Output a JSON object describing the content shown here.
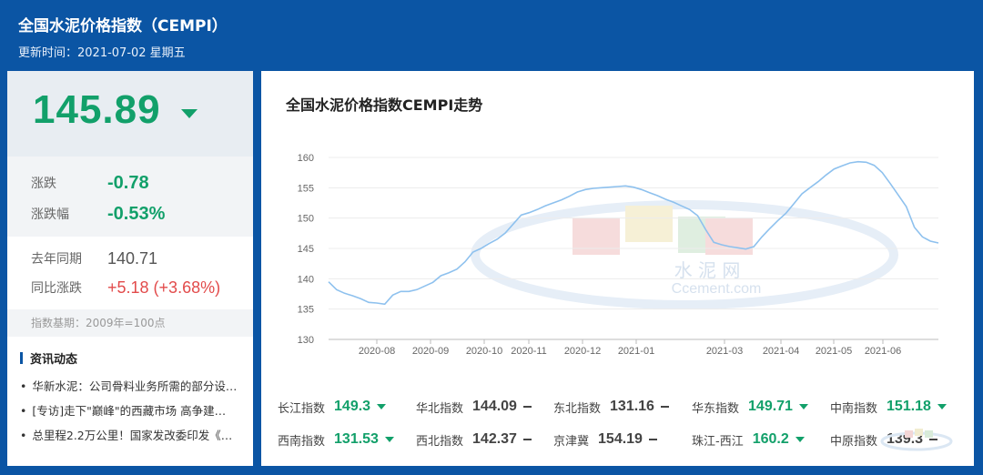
{
  "header": {
    "title": "全国水泥价格指数（CEMPI）",
    "updated": "更新时间：2021-07-02 星期五"
  },
  "summary": {
    "value": "145.89",
    "change_label": "涨跌",
    "change_value": "-0.78",
    "change_pct_label": "涨跌幅",
    "change_pct_value": "-0.53%",
    "last_year_label": "去年同期",
    "last_year_value": "140.71",
    "yoy_label": "同比涨跌",
    "yoy_value": "+5.18 (+3.68%)",
    "base_note": "指数基期：2009年=100点"
  },
  "news": {
    "title": "资讯动态",
    "items": [
      "华新水泥：公司骨料业务所需的部分设…",
      "[专访]走下\"巅峰\"的西藏市场 高争建…",
      "总里程2.2万公里！国家发改委印发《…"
    ]
  },
  "chart": {
    "title": "全国水泥价格指数CEMPI走势",
    "watermark_cn": "水 泥 网",
    "watermark_en": "Ccement.com",
    "line_color": "#8ec1ee"
  },
  "chart_data": {
    "type": "line",
    "ylim": [
      130,
      160
    ],
    "yticks": [
      "160",
      "155",
      "150",
      "145",
      "140",
      "135",
      "130"
    ],
    "xticks": [
      "2020-08",
      "2020-09",
      "2020-10",
      "2020-11",
      "2020-12",
      "2021-01",
      "2021-03",
      "2021-04",
      "2021-05",
      "2021-06"
    ],
    "values": [
      139.5,
      138.2,
      137.6,
      137.2,
      136.7,
      136.1,
      136.0,
      135.8,
      137.3,
      137.9,
      137.9,
      138.2,
      138.8,
      139.4,
      140.5,
      141.0,
      141.6,
      142.8,
      144.4,
      145.0,
      145.8,
      146.5,
      147.5,
      149.0,
      150.5,
      150.9,
      151.4,
      152.0,
      152.5,
      153.0,
      153.6,
      154.3,
      154.7,
      154.9,
      155.0,
      155.1,
      155.2,
      155.3,
      155.1,
      154.7,
      154.2,
      153.7,
      153.1,
      152.6,
      152.0,
      151.4,
      150.4,
      148.1,
      146.0,
      145.6,
      145.3,
      145.1,
      144.9,
      145.3,
      146.9,
      148.3,
      149.6,
      150.8,
      152.4,
      154.0,
      155.0,
      156.0,
      157.1,
      158.1,
      158.6,
      159.1,
      159.3,
      159.2,
      158.7,
      157.5,
      155.7,
      153.8,
      151.9,
      148.5,
      146.9,
      146.2,
      145.9
    ]
  },
  "indices": [
    {
      "name": "长江指数",
      "value": "149.3",
      "dir": "down"
    },
    {
      "name": "华北指数",
      "value": "144.09",
      "dir": "flat"
    },
    {
      "name": "东北指数",
      "value": "131.16",
      "dir": "flat"
    },
    {
      "name": "华东指数",
      "value": "149.71",
      "dir": "down"
    },
    {
      "name": "中南指数",
      "value": "151.18",
      "dir": "down"
    },
    {
      "name": "西南指数",
      "value": "131.53",
      "dir": "down"
    },
    {
      "name": "西北指数",
      "value": "142.37",
      "dir": "flat"
    },
    {
      "name": "京津冀",
      "value": "154.19",
      "dir": "flat"
    },
    {
      "name": "珠江-西江",
      "value": "160.2",
      "dir": "down"
    },
    {
      "name": "中原指数",
      "value": "139.3",
      "dir": "flat"
    }
  ]
}
